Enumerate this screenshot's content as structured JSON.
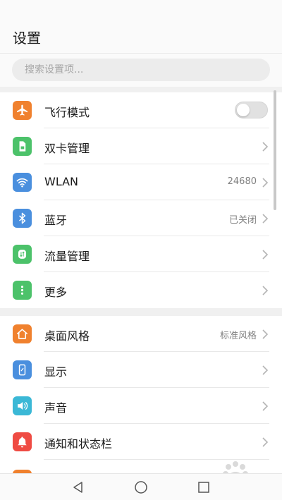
{
  "header": {
    "title": "设置"
  },
  "search": {
    "placeholder": "搜索设置项..."
  },
  "group1": [
    {
      "label": "飞行模式",
      "icon": "airplane-icon",
      "color": "#f0812e",
      "control": "toggle",
      "toggle_on": false
    },
    {
      "label": "双卡管理",
      "icon": "sim-card-icon",
      "color": "#4cc26a",
      "control": "chevron"
    },
    {
      "label": "WLAN",
      "icon": "wifi-icon",
      "color": "#4a8fde",
      "value": "24680",
      "control": "chevron"
    },
    {
      "label": "蓝牙",
      "icon": "bluetooth-icon",
      "color": "#4a8fde",
      "value": "已关闭",
      "control": "chevron"
    },
    {
      "label": "流量管理",
      "icon": "data-usage-icon",
      "color": "#4cc26a",
      "control": "chevron"
    },
    {
      "label": "更多",
      "icon": "more-icon",
      "color": "#4cc26a",
      "control": "chevron"
    }
  ],
  "group2": [
    {
      "label": "桌面风格",
      "icon": "home-icon",
      "color": "#f0812e",
      "value": "标准风格",
      "control": "chevron"
    },
    {
      "label": "显示",
      "icon": "display-icon",
      "color": "#4a8fde",
      "control": "chevron"
    },
    {
      "label": "声音",
      "icon": "speaker-icon",
      "color": "#3bb8d6",
      "control": "chevron"
    },
    {
      "label": "通知和状态栏",
      "icon": "bell-icon",
      "color": "#ef4b43",
      "control": "chevron"
    }
  ],
  "navbar": {
    "back": "back-triangle-icon",
    "home": "home-circle-icon",
    "recents": "recents-square-icon"
  },
  "colors": {
    "accent_orange": "#f0812e",
    "accent_green": "#4cc26a",
    "accent_blue": "#4a8fde",
    "accent_red": "#ef4b43"
  }
}
